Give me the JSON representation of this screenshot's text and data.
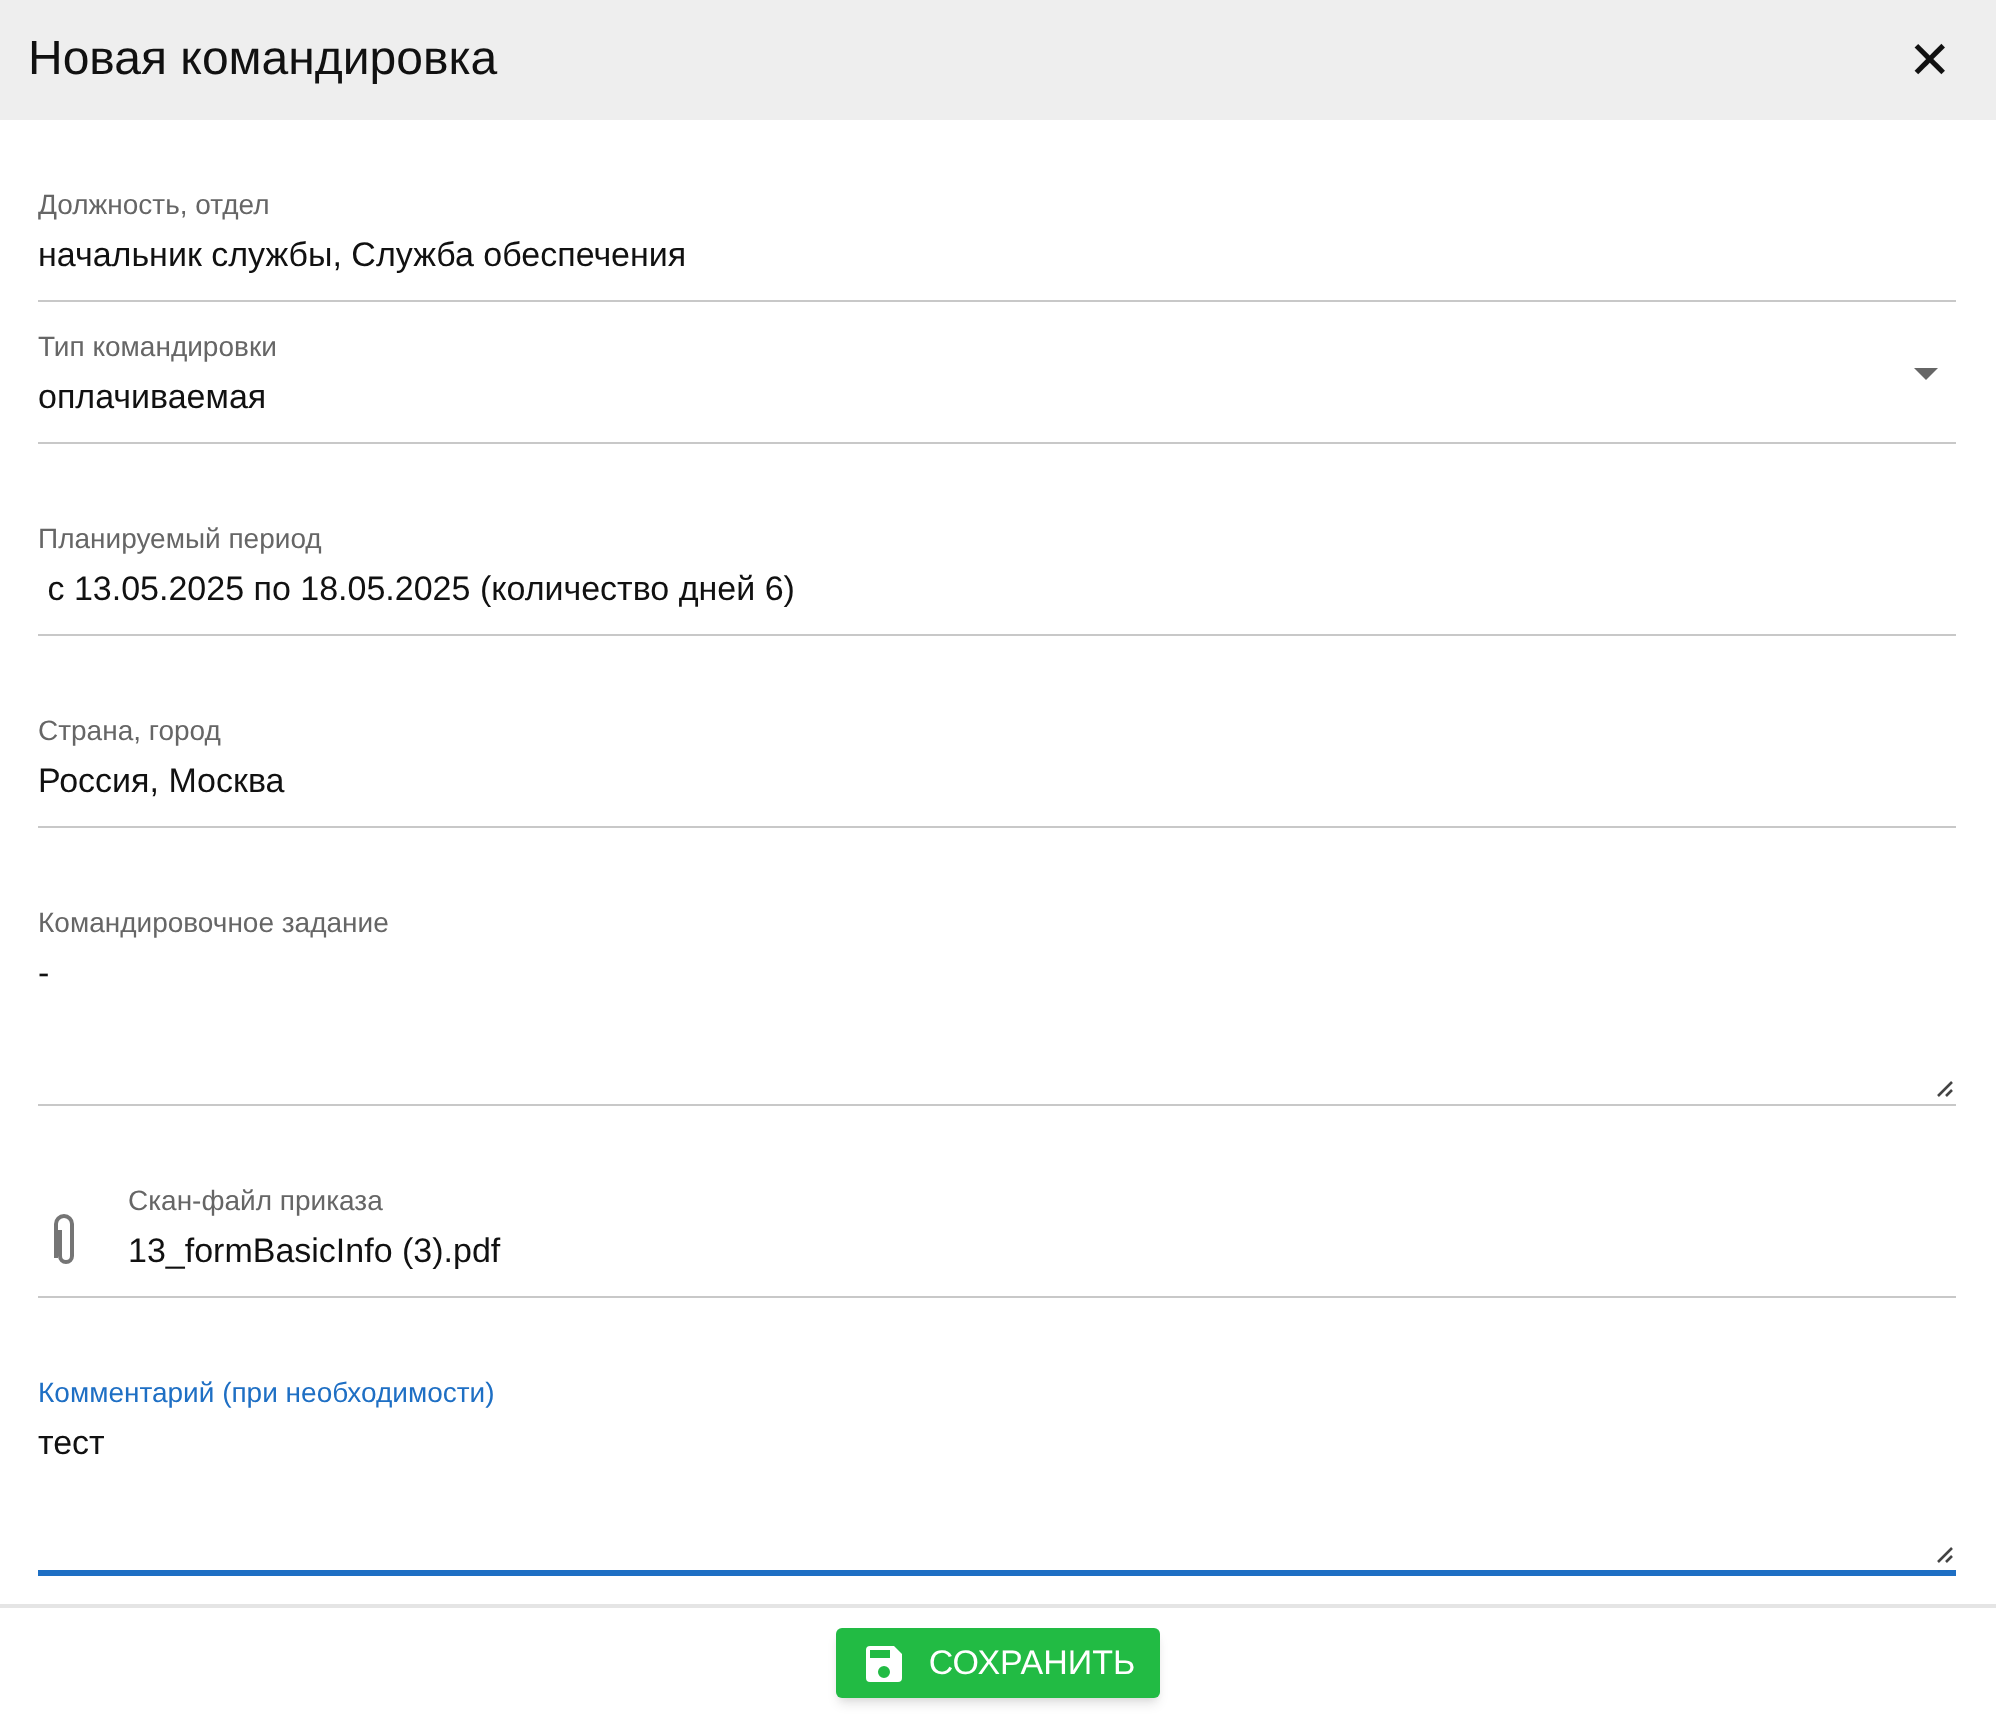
{
  "dialog": {
    "title": "Новая командировка",
    "close": "✕"
  },
  "fields": [
    {
      "kind": "text",
      "label": "Должность, отдел",
      "value": "начальник службы, Служба обеспечения",
      "focused": false
    },
    {
      "kind": "select",
      "label": "Тип командировки",
      "value": "оплачиваемая",
      "focused": false
    },
    {
      "kind": "text",
      "label": "Планируемый период",
      "value": " с 13.05.2025 по 18.05.2025 (количество дней 6)",
      "focused": false
    },
    {
      "kind": "text",
      "label": "Страна, город",
      "value": "Россия, Москва",
      "focused": false
    },
    {
      "kind": "textarea",
      "label": "Командировочное задание",
      "value": "-",
      "focused": false
    },
    {
      "kind": "file",
      "label": "Скан-файл приказа",
      "value": "13_formBasicInfo (3).pdf",
      "focused": false
    },
    {
      "kind": "textarea",
      "label": "Комментарий (при необходимости)",
      "value": "тест",
      "focused": true
    }
  ],
  "save_button": "СОХРАНИТЬ"
}
